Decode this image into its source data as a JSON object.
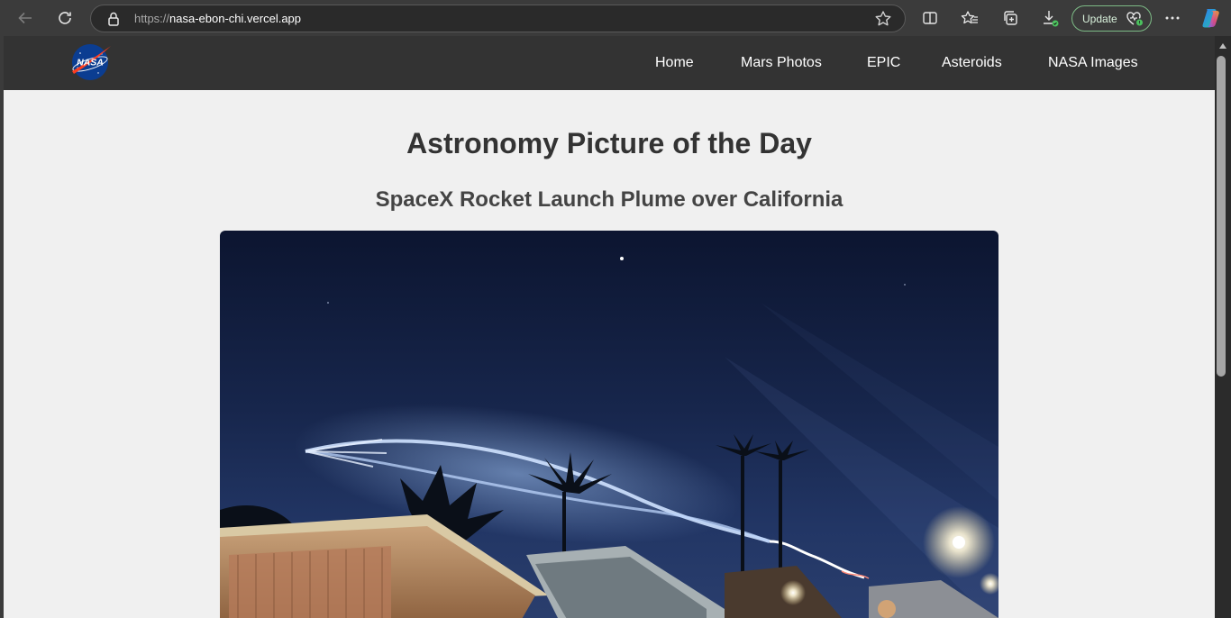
{
  "browser": {
    "url_scheme": "https://",
    "url_host": "nasa-ebon-chi.vercel.app",
    "update_label": "Update",
    "icons": [
      "back-icon",
      "refresh-icon",
      "lock-icon",
      "favorite-star-icon",
      "split-screen-icon",
      "favorites-icon",
      "collections-icon",
      "downloads-icon",
      "more-icon",
      "copilot-icon"
    ]
  },
  "site": {
    "logo_text": "NASA",
    "nav": [
      "Home",
      "Mars Photos",
      "EPIC",
      "Asteroids",
      "NASA Images"
    ]
  },
  "main": {
    "page_title": "Astronomy Picture of the Day",
    "apod_title": "SpaceX Rocket Launch Plume over California"
  },
  "colors": {
    "browser_bg": "#3b3b3b",
    "nav_bg": "#333333",
    "page_bg": "#f0f0f0",
    "nasa_blue": "#0b3d91",
    "nasa_red": "#fc3d21",
    "update_border": "#7dbb86"
  }
}
